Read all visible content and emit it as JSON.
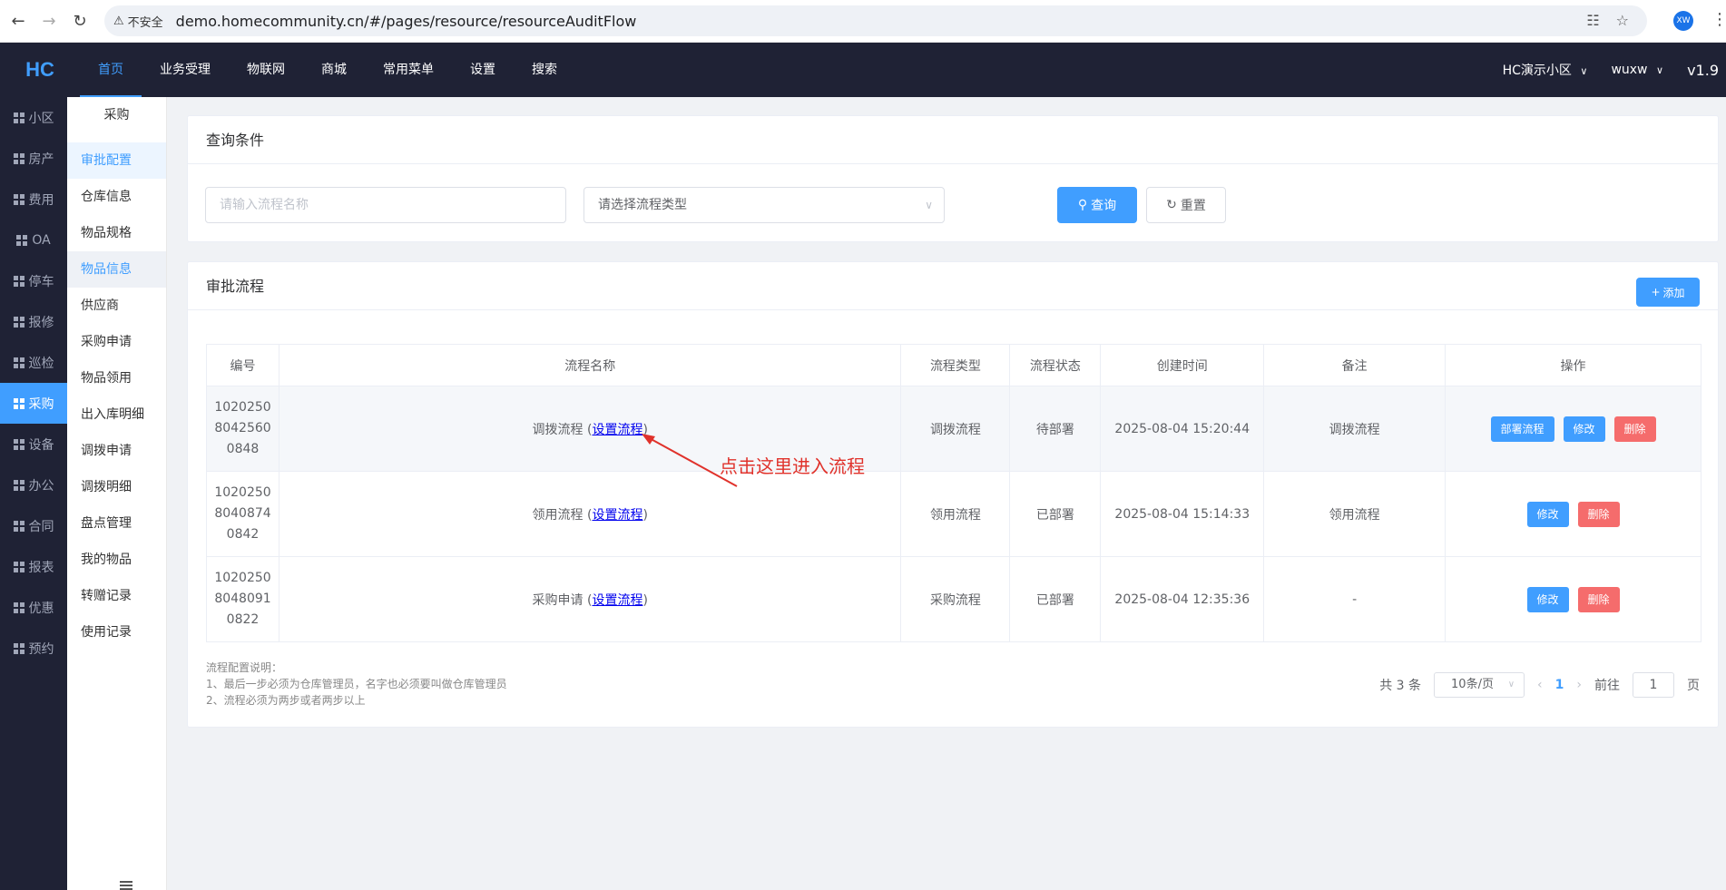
{
  "browser": {
    "insecure_label": "不安全",
    "url": "demo.homecommunity.cn/#/pages/resource/resourceAuditFlow",
    "profile_initials": "XW"
  },
  "header": {
    "logo": "HC",
    "nav": [
      "首页",
      "业务受理",
      "物联网",
      "商城",
      "常用菜单",
      "设置",
      "搜索"
    ],
    "community": "HC演示小区",
    "user": "wuxw",
    "version": "v1.9"
  },
  "leftnav": [
    "小区",
    "房产",
    "费用",
    "OA",
    "停车",
    "报修",
    "巡检",
    "采购",
    "设备",
    "办公",
    "合同",
    "报表",
    "优惠",
    "预约"
  ],
  "submenu": {
    "title": "采购",
    "items": [
      "审批配置",
      "仓库信息",
      "物品规格",
      "物品信息",
      "供应商",
      "采购申请",
      "物品领用",
      "出入库明细",
      "调拨申请",
      "调拨明细",
      "盘点管理",
      "我的物品",
      "转赠记录",
      "使用记录"
    ]
  },
  "query": {
    "title": "查询条件",
    "name_placeholder": "请输入流程名称",
    "type_placeholder": "请选择流程类型",
    "search_label": "查询",
    "reset_label": "重置"
  },
  "flows": {
    "title": "审批流程",
    "add_label": "添加",
    "columns": [
      "编号",
      "流程名称",
      "流程类型",
      "流程状态",
      "创建时间",
      "备注",
      "操作"
    ],
    "rows": [
      {
        "id": [
          "1020250",
          "8042560",
          "0848"
        ],
        "name": "调拨流程",
        "link": "设置流程",
        "type": "调拨流程",
        "status": "待部署",
        "created": "2025-08-04 15:20:44",
        "remark": "调拨流程",
        "ops": [
          "部署流程",
          "修改",
          "删除"
        ]
      },
      {
        "id": [
          "1020250",
          "8040874",
          "0842"
        ],
        "name": "领用流程",
        "link": "设置流程",
        "type": "领用流程",
        "status": "已部署",
        "created": "2025-08-04 15:14:33",
        "remark": "领用流程",
        "ops": [
          "修改",
          "删除"
        ]
      },
      {
        "id": [
          "1020250",
          "8048091",
          "0822"
        ],
        "name": "采购申请",
        "link": "设置流程",
        "type": "采购流程",
        "status": "已部署",
        "created": "2025-08-04 12:35:36",
        "remark": "-",
        "ops": [
          "修改",
          "删除"
        ]
      }
    ],
    "notes": [
      "流程配置说明：",
      "1、最后一步必须为仓库管理员，名字也必须要叫做仓库管理员",
      "2、流程必须为两步或者两步以上"
    ],
    "pager": {
      "total": "共 3 条",
      "page_size": "10条/页",
      "current": "1",
      "goto_label": "前往",
      "goto_value": "1",
      "page_suffix": "页"
    }
  },
  "annotation": "点击这里进入流程",
  "colors": {
    "primary": "#409eff",
    "danger": "#f56c6c",
    "dark": "#1f2235",
    "annotation": "#e0322b"
  }
}
